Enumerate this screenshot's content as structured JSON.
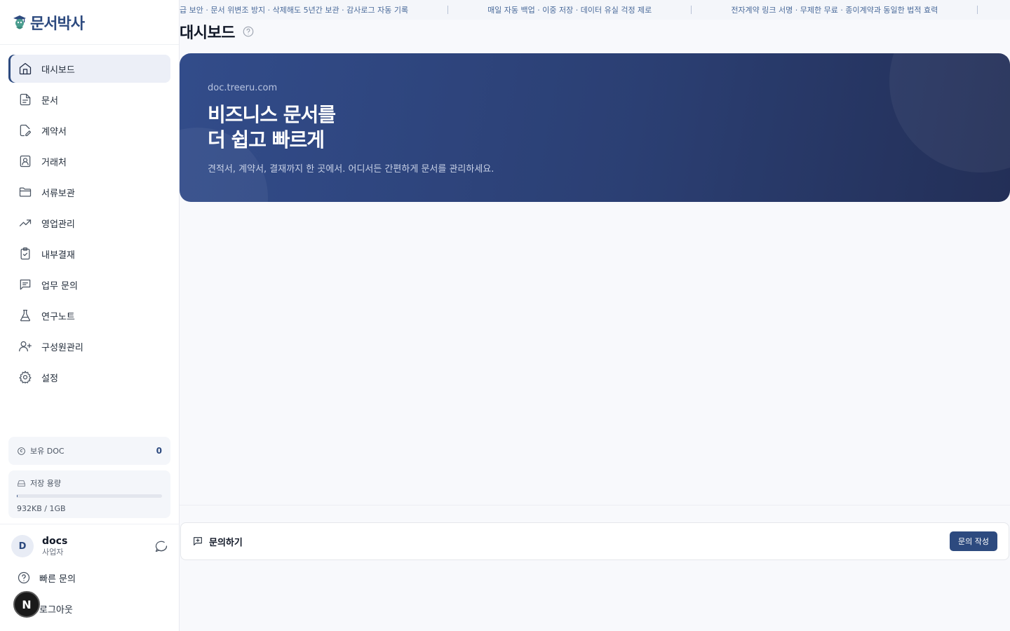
{
  "app": {
    "name": "문서박사"
  },
  "sidebar": {
    "items": [
      {
        "label": "대시보드",
        "icon": "home-icon",
        "active": true
      },
      {
        "label": "문서",
        "icon": "document-icon"
      },
      {
        "label": "계약서",
        "icon": "contract-edit-icon"
      },
      {
        "label": "거래처",
        "icon": "contact-card-icon"
      },
      {
        "label": "서류보관",
        "icon": "folder-icon"
      },
      {
        "label": "영업관리",
        "icon": "trending-up-icon"
      },
      {
        "label": "내부결재",
        "icon": "clipboard-check-icon"
      },
      {
        "label": "업무 문의",
        "icon": "message-square-icon"
      },
      {
        "label": "연구노트",
        "icon": "flask-icon"
      },
      {
        "label": "구성원관리",
        "icon": "user-plus-icon"
      },
      {
        "label": "설정",
        "icon": "gear-icon"
      }
    ],
    "doc_balance": {
      "label": "보유 DOC",
      "value": "0"
    },
    "storage": {
      "label": "저장 용량",
      "text": "932KB / 1GB",
      "used_fraction": 0.0009
    },
    "user": {
      "initial": "D",
      "name": "docs",
      "role": "사업자"
    },
    "quick_inquiry": "빠른 문의",
    "logout": "로그아웃",
    "badge": "N"
  },
  "ticker": {
    "items": [
      "급 보안 · 문서 위변조 방지 · 삭제해도 5년간 보관 · 감사로그 자동 기록",
      "매일 자동 백업 · 이중 저장 · 데이터 유실 걱정 제로",
      "전자계약 링크 서명 · 무제한 무료 · 종이계약과 동일한 법적 효력"
    ]
  },
  "main": {
    "title": "대시보드",
    "banner": {
      "domain": "doc.treeru.com",
      "title_line1": "비즈니스 문서를",
      "title_line2": "더 쉽고 빠르게",
      "subtitle": "견적서, 계약서, 결재까지 한 곳에서. 어디서든 간편하게 문서를 관리하세요."
    },
    "inquiry": {
      "label": "문의하기",
      "button": "문의 작성"
    }
  },
  "colors": {
    "brand": "#2d4a7f",
    "banner_start": "#324c8a",
    "banner_end": "#232f57"
  }
}
